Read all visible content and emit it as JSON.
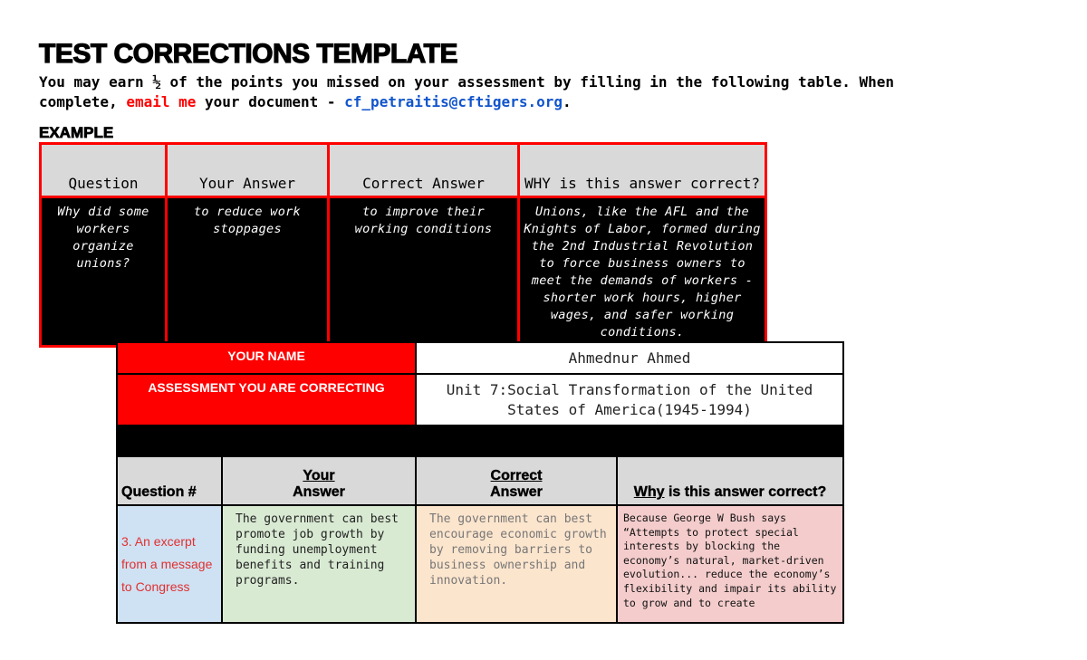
{
  "title": "TEST CORRECTIONS TEMPLATE",
  "intro": {
    "part1": "You may earn ½ of the points you missed on your assessment by filling in the following table. When complete, ",
    "email_me": "email me",
    "part2": " your document - ",
    "email": "cf_petraitis@cftigers.org",
    "part3": "."
  },
  "example": {
    "label": "EXAMPLE",
    "headers": {
      "question": "Question",
      "your_answer": "Your Answer",
      "correct_answer": "Correct Answer",
      "why": "WHY is this answer correct?"
    },
    "row": {
      "question": "Why did some workers organize unions?",
      "your_answer": "to reduce work stoppages",
      "correct_answer": "to improve their working conditions",
      "why": "Unions, like the AFL and the Knights of Labor, formed during the 2nd Industrial Revolution to force business owners to meet the demands of workers - shorter work hours, higher wages, and safer working conditions."
    }
  },
  "form": {
    "name_label": "YOUR NAME",
    "name_value": "Ahmednur Ahmed",
    "assessment_label": "ASSESSMENT YOU ARE CORRECTING",
    "assessment_value": "Unit 7:Social Transformation of the United States of America(1945-1994)",
    "headers": {
      "question": "Question #",
      "your_answer_u": "Your",
      "your_answer_rest": "Answer",
      "correct_answer_u": "Correct",
      "correct_answer_rest": "Answer",
      "why_u": "Why",
      "why_rest": " is this answer correct?"
    },
    "rows": [
      {
        "question": "3. An excerpt from a message to Congress",
        "your_answer": "The government can best promote job growth by funding unemployment benefits and training programs.",
        "correct_answer": "The government can best encourage economic growth by removing barriers to business ownership and innovation.",
        "why": "Because George W Bush says “Attempts to protect special interests by blocking the economy’s natural, market-driven evolution... reduce the economy’s flexibility and impair its ability to grow and to create"
      }
    ]
  },
  "colors": {
    "accent_red": "#ff0000",
    "link_blue": "#1155cc",
    "header_gray": "#d9d9d9",
    "question_blue": "#cfe2f3",
    "your_answer_green": "#d9ead3",
    "correct_answer_orange": "#fce5cd",
    "why_pink": "#f4cccc"
  }
}
